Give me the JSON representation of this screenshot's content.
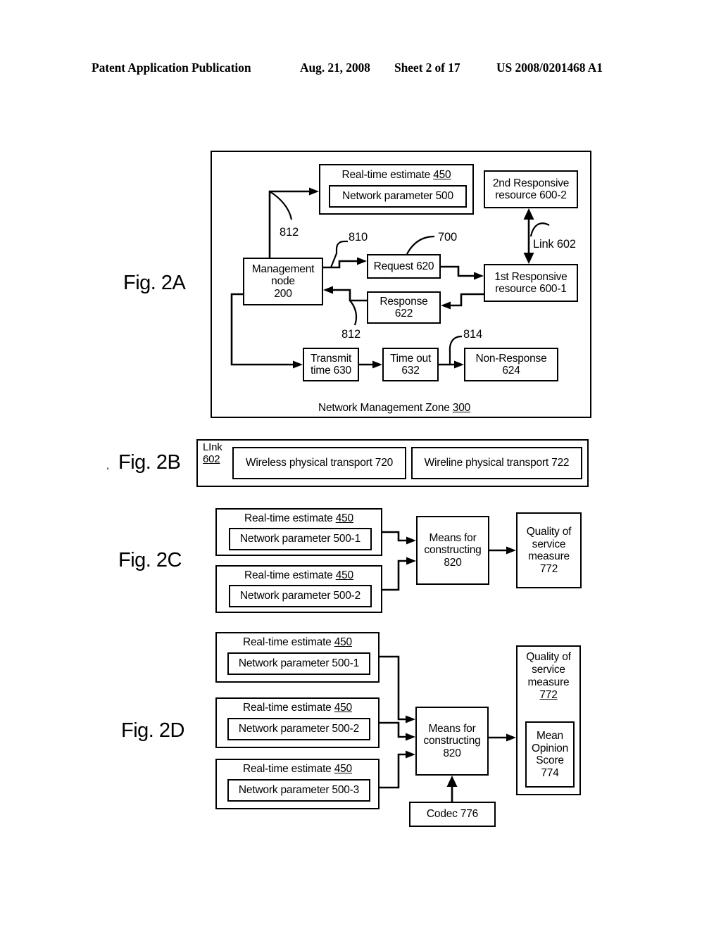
{
  "header": {
    "publication": "Patent Application Publication",
    "date": "Aug. 21, 2008",
    "sheet": "Sheet 2 of 17",
    "patent_number": "US 2008/0201468 A1"
  },
  "figures": {
    "fig2a": {
      "label": "Fig. 2A",
      "zone_label_text": "Network Management Zone ",
      "zone_label_num": "300",
      "boxes": {
        "real_time_estimate_title": "Real-time estimate ",
        "real_time_estimate_num": "450",
        "network_parameter": "Network parameter 500",
        "responsive_2nd_line1": "2nd Responsive",
        "responsive_2nd_line2": "resource 600-2",
        "responsive_1st_line1": "1st Responsive",
        "responsive_1st_line2": "resource 600-1",
        "management_node_line1": "Management",
        "management_node_line2": "node",
        "management_node_line3": "200",
        "request": "Request 620",
        "response_line1": "Response",
        "response_line2": "622",
        "transmit_time_line1": "Transmit",
        "transmit_time_line2": "time 630",
        "time_out_line1": "Time out",
        "time_out_line2": "632",
        "non_response_line1": "Non-Response",
        "non_response_line2": "624"
      },
      "ref_numbers": {
        "n812_top": "812",
        "n810": "810",
        "n700": "700",
        "n812_mid": "812",
        "n814": "814",
        "link602": "Link 602"
      }
    },
    "fig2b": {
      "label": "Fig. 2B",
      "link_word": "LInk",
      "link_num": "602",
      "wireless": "Wireless physical transport 720",
      "wireline": "Wireline physical transport 722"
    },
    "fig2c": {
      "label": "Fig. 2C",
      "rte1_title": "Real-time estimate ",
      "rte1_num": "450",
      "rte1_inner": "Network parameter 500-1",
      "rte2_title": "Real-time estimate ",
      "rte2_num": "450",
      "rte2_inner": "Network parameter 500-2",
      "means_line1": "Means for",
      "means_line2": "constructing",
      "means_line3": "820",
      "qos_line1": "Quality of",
      "qos_line2": "service",
      "qos_line3": "measure",
      "qos_line4": "772"
    },
    "fig2d": {
      "label": "Fig. 2D",
      "rte1_title": "Real-time estimate ",
      "rte1_num": "450",
      "rte1_inner": "Network parameter 500-1",
      "rte2_title": "Real-time estimate ",
      "rte2_num": "450",
      "rte2_inner": "Network parameter 500-2",
      "rte3_title": "Real-time estimate ",
      "rte3_num": "450",
      "rte3_inner": "Network parameter 500-3",
      "means_line1": "Means for",
      "means_line2": "constructing",
      "means_line3": "820",
      "qos_line1": "Quality of",
      "qos_line2": "service",
      "qos_line3": "measure",
      "qos_num": "772",
      "mos_line1": "Mean",
      "mos_line2": "Opinion",
      "mos_line3": "Score",
      "mos_line4": "774",
      "codec": "Codec 776"
    }
  },
  "stray_mark": ","
}
